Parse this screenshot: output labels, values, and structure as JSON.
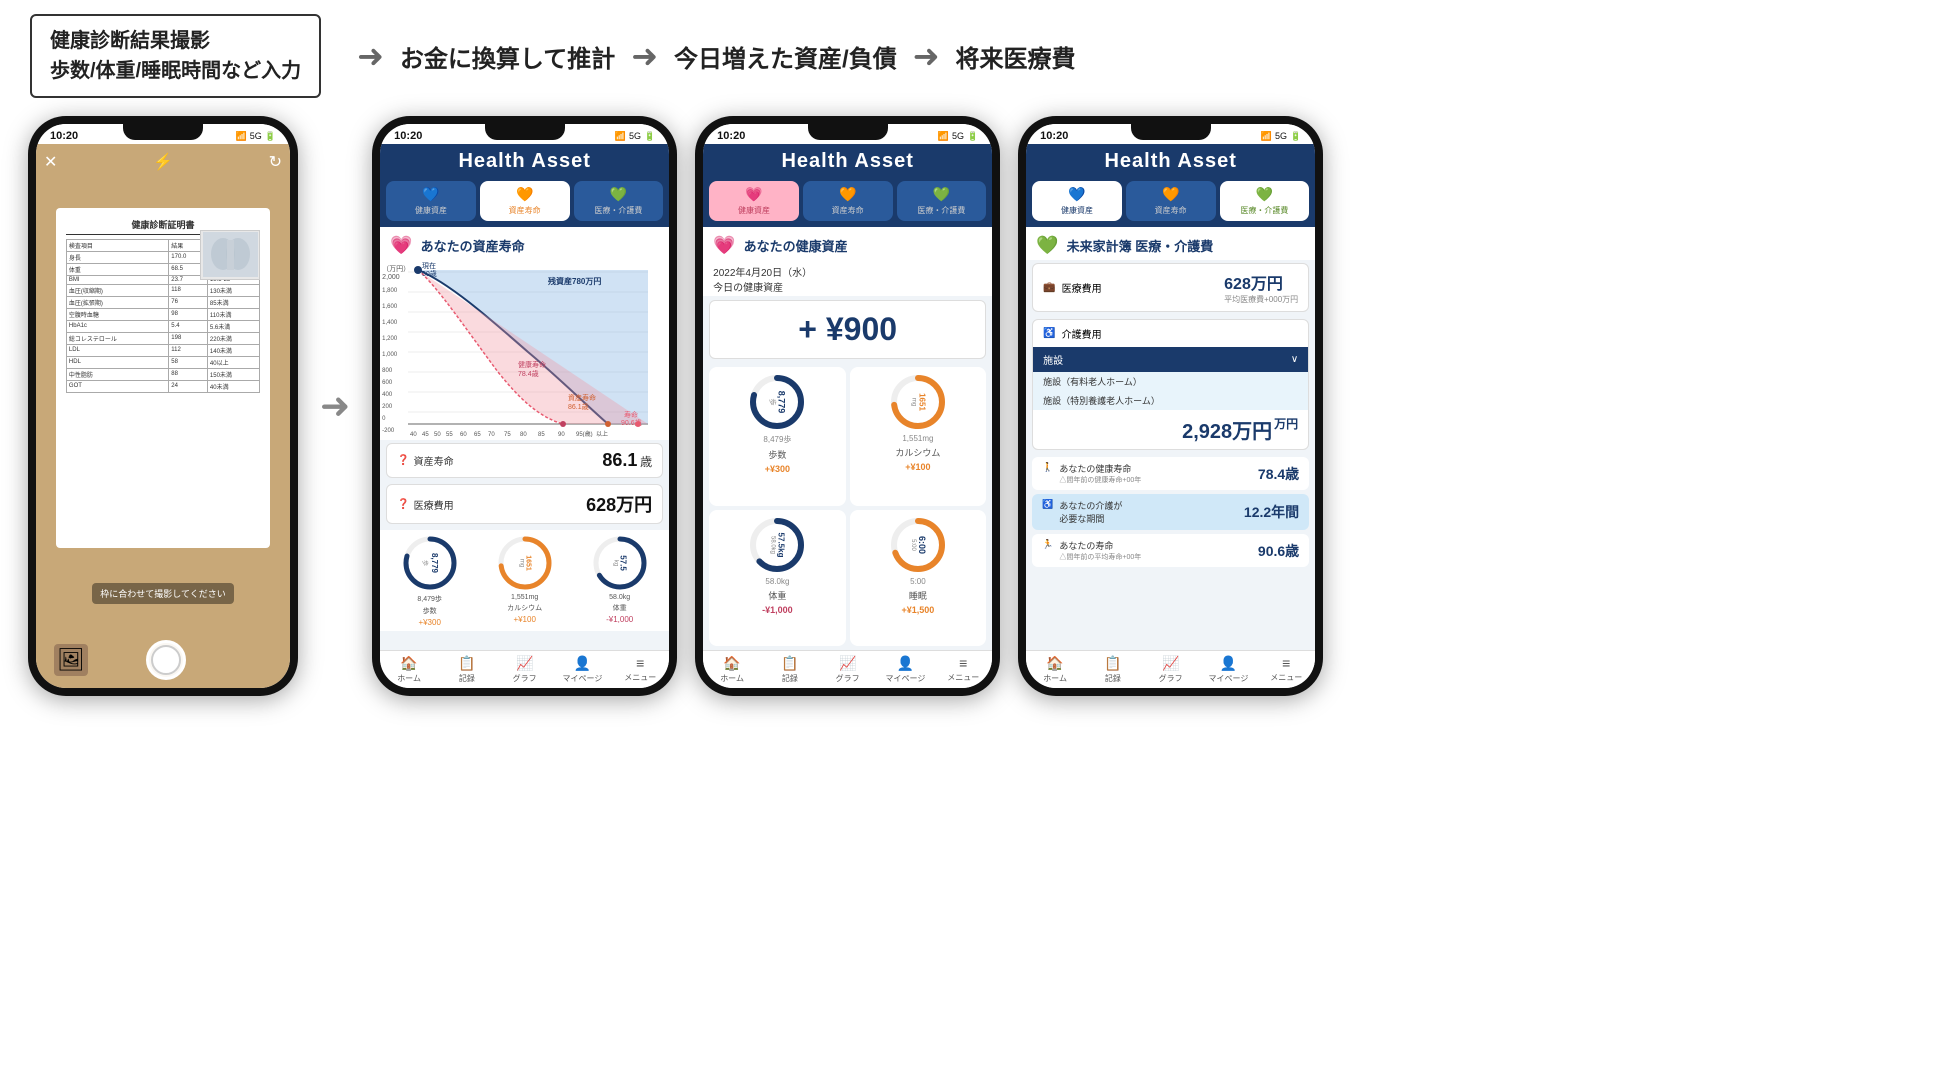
{
  "topSection": {
    "leftBox": {
      "line1": "健康診断結果撮影",
      "line2": "歩数/体重/睡眠時間など入力"
    },
    "labels": [
      "お金に換算して推計",
      "今日増えた資産/負債",
      "将来医療費"
    ]
  },
  "phone1": {
    "status": "10:20",
    "signal": "5G",
    "hint": "枠に合わせて撮影してください",
    "doc": {
      "title": "健康診断証明書"
    }
  },
  "phone2": {
    "status": "10:20",
    "signal": "5G",
    "header": "Health Asset",
    "tabs": [
      {
        "label": "健康資産",
        "icon": "💙",
        "state": "active-blue"
      },
      {
        "label": "資産寿命",
        "icon": "🧡",
        "state": "active-orange"
      },
      {
        "label": "医療・介護費",
        "icon": "💚",
        "state": "inactive"
      }
    ],
    "sectionTitle": "あなたの資産寿命",
    "sectionIcon": "💗",
    "chart": {
      "yMax": 2000,
      "yMin": -200,
      "currentAge": 50,
      "lifeExpectancy": 90.6,
      "healthLifeLabel": "健康寿命\n78.4歳",
      "assetLifeLabel": "資産寿命\n86.1歳",
      "deathLabel": "寿命\n90.6歳",
      "residualAsset": "残資産 780万円",
      "currentLabel": "現在\n50歳"
    },
    "assetLifeValue": "86.1",
    "assetLifeUnit": "歳",
    "assetLifeLabel": "資産寿命",
    "medicalCostValue": "628万円",
    "medicalCostLabel": "医療費用",
    "gauges": [
      {
        "label": "歩数",
        "value": "8,779",
        "unit": "歩",
        "subValue": "8,479歩",
        "change": "+¥300"
      },
      {
        "label": "カルシウム",
        "value": "1651",
        "unit": "mg",
        "subValue": "1,551mg",
        "change": "+¥100"
      },
      {
        "label": "体重",
        "value": "57.5",
        "unit": "kg",
        "subValue": "58.0kg",
        "change": "-¥1,000"
      }
    ],
    "navItems": [
      {
        "icon": "🏠",
        "label": "ホーム"
      },
      {
        "icon": "📋",
        "label": "記録"
      },
      {
        "icon": "📈",
        "label": "グラフ"
      },
      {
        "icon": "👤",
        "label": "マイページ"
      },
      {
        "icon": "≡",
        "label": "メニュー"
      }
    ]
  },
  "phone3": {
    "status": "10:20",
    "signal": "5G",
    "header": "Health Asset",
    "tabs": [
      {
        "label": "健康資産",
        "icon": "💗",
        "state": "active-pink"
      },
      {
        "label": "資産寿命",
        "icon": "🧡",
        "state": "inactive"
      },
      {
        "label": "医療・介護費",
        "icon": "💚",
        "state": "inactive"
      }
    ],
    "sectionTitle": "あなたの健康資産",
    "sectionIcon": "💗",
    "dateLabel": "2022年4月20日（水）",
    "todayLabel": "今日の健康資産",
    "plusValue": "+ ¥900",
    "gauges": [
      {
        "label": "歩数",
        "value": "8,779",
        "unit": "歩",
        "subValue": "8,479歩",
        "change": "+¥300",
        "color": "#1a3a6b"
      },
      {
        "label": "カルシウム",
        "value": "1651",
        "unit": "mg",
        "subValue": "1,551mg",
        "change": "+¥100",
        "color": "#e8842a"
      },
      {
        "label": "体重",
        "value": "57.5",
        "unit": "kg",
        "subValue": "58.0kg",
        "change": "-¥1,000",
        "color": "#1a3a6b"
      },
      {
        "label": "睡眠",
        "value": "6:00",
        "unit": "",
        "subValue": "5:00",
        "change": "+¥1,500",
        "color": "#e8842a"
      }
    ],
    "navItems": [
      {
        "icon": "🏠",
        "label": "ホーム"
      },
      {
        "icon": "📋",
        "label": "記録"
      },
      {
        "icon": "📈",
        "label": "グラフ"
      },
      {
        "icon": "👤",
        "label": "マイページ"
      },
      {
        "icon": "≡",
        "label": "メニュー"
      }
    ]
  },
  "phone4": {
    "status": "10:20",
    "signal": "5G",
    "header": "Health Asset",
    "tabs": [
      {
        "label": "健康資産",
        "icon": "💙",
        "state": "active-blue"
      },
      {
        "label": "資産寿命",
        "icon": "🧡",
        "state": "inactive"
      },
      {
        "label": "医療・介護費",
        "icon": "💚",
        "state": "active-green"
      }
    ],
    "sectionTitle": "未来家計簿 医療・介護費",
    "sectionIcon": "💚",
    "medicalCost": "628万円",
    "medicalSubtext": "平均医療費+000万円",
    "careFacility": "施設",
    "facilityItems": [
      "施設（有料老人ホーム）",
      "施設（特別養護老人ホーム）"
    ],
    "totalCare": "2,928万円",
    "summaryItems": [
      {
        "icon": "🚶",
        "label": "あなたの健康寿命",
        "sub": "△間年前の健康寿命+00年",
        "value": "78.4歳"
      },
      {
        "icon": "♿",
        "label": "あなたの介護が\n必要な期間",
        "sub": "",
        "value": "12.2年間",
        "highlight": true
      },
      {
        "icon": "🏃",
        "label": "あなたの寿命",
        "sub": "△間年前の平均寿命+00年",
        "value": "90.6歳"
      }
    ],
    "navItems": [
      {
        "icon": "🏠",
        "label": "ホーム"
      },
      {
        "icon": "📋",
        "label": "記録"
      },
      {
        "icon": "📈",
        "label": "グラフ"
      },
      {
        "icon": "👤",
        "label": "マイページ"
      },
      {
        "icon": "≡",
        "label": "メニュー"
      }
    ]
  }
}
